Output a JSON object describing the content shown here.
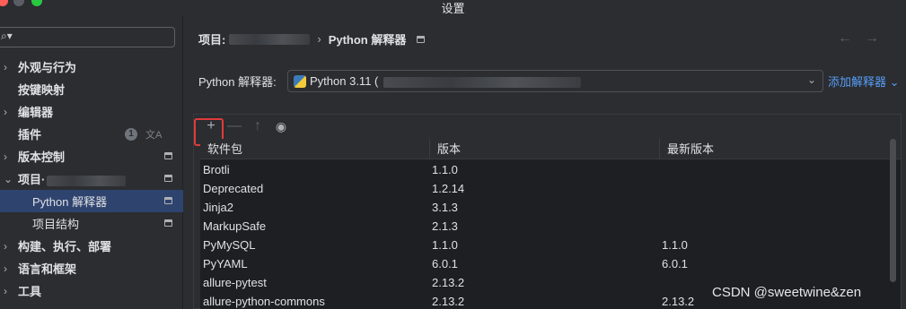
{
  "window": {
    "title": "设置"
  },
  "sidebar": {
    "search_placeholder": "",
    "items": [
      {
        "label": "外观与行为",
        "chevron": "›",
        "badge": "",
        "has_window_icon": false
      },
      {
        "label": "按键映射",
        "chevron": "",
        "badge": "",
        "has_window_icon": false
      },
      {
        "label": "编辑器",
        "chevron": "›",
        "badge": "",
        "has_window_icon": false
      },
      {
        "label": "插件",
        "chevron": "",
        "badge": "1",
        "has_window_icon": false
      },
      {
        "label": "版本控制",
        "chevron": "›",
        "badge": "",
        "has_window_icon": true
      },
      {
        "label": "项目·",
        "chevron": "⌄",
        "badge": "",
        "has_window_icon": true
      },
      {
        "label": "Python 解释器",
        "chevron": "",
        "badge": "",
        "has_window_icon": true,
        "selected": true
      },
      {
        "label": "项目结构",
        "chevron": "",
        "badge": "",
        "has_window_icon": true
      },
      {
        "label": "构建、执行、部署",
        "chevron": "›",
        "badge": "",
        "has_window_icon": false
      },
      {
        "label": "语言和框架",
        "chevron": "›",
        "badge": "",
        "has_window_icon": false
      },
      {
        "label": "工具",
        "chevron": "›",
        "badge": "",
        "has_window_icon": false
      }
    ]
  },
  "breadcrumb": {
    "project": "项目:",
    "page": "Python 解释器"
  },
  "interpreter": {
    "label": "Python 解释器:",
    "value": "Python 3.11 (",
    "add_link": "添加解释器"
  },
  "toolbar": {
    "add": "+",
    "remove": "—",
    "upgrade": "↑",
    "show": "◉"
  },
  "table": {
    "columns": [
      "软件包",
      "版本",
      "最新版本"
    ],
    "rows": [
      [
        "Brotli",
        "1.1.0",
        ""
      ],
      [
        "Deprecated",
        "1.2.14",
        ""
      ],
      [
        "Jinja2",
        "3.1.3",
        ""
      ],
      [
        "MarkupSafe",
        "2.1.3",
        ""
      ],
      [
        "PyMySQL",
        "1.1.0",
        "1.1.0"
      ],
      [
        "PyYAML",
        "6.0.1",
        "6.0.1"
      ],
      [
        "allure-pytest",
        "2.13.2",
        ""
      ],
      [
        "allure-python-commons",
        "2.13.2",
        "2.13.2"
      ]
    ]
  },
  "watermark": "CSDN @sweetwine&zen",
  "colors": {
    "accent": "#589df6",
    "selected": "#2e436e",
    "highlight_box": "#e03b3b"
  }
}
